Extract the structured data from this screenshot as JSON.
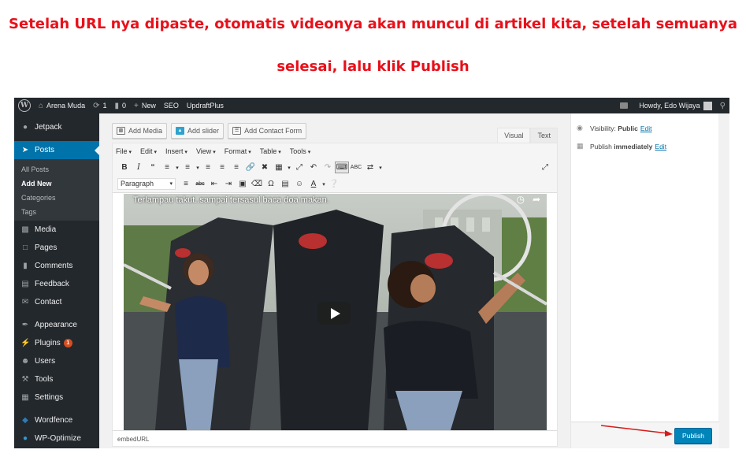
{
  "caption": {
    "line1": "Setelah URL nya dipaste, otomatis videonya akan muncul di artikel kita, setelah semuanya",
    "line2": "selesai, lalu klik Publish",
    "color": "#e8101a"
  },
  "adminbar": {
    "logo": "W",
    "site_name": "Arena Muda",
    "updates_count": "1",
    "comments_count": "0",
    "new_label": "New",
    "seo_label": "SEO",
    "updraft_label": "UpdraftPlus",
    "howdy": "Howdy, Edo Wijaya"
  },
  "sidebar": {
    "items": [
      {
        "label": "Jetpack",
        "icon": "jetpack-icon"
      },
      {
        "label": "Posts",
        "icon": "pin-icon"
      },
      {
        "label": "Media",
        "icon": "media-icon"
      },
      {
        "label": "Pages",
        "icon": "pages-icon"
      },
      {
        "label": "Comments",
        "icon": "comments-icon"
      },
      {
        "label": "Feedback",
        "icon": "feedback-icon"
      },
      {
        "label": "Contact",
        "icon": "mail-icon"
      },
      {
        "label": "Appearance",
        "icon": "brush-icon"
      },
      {
        "label": "Plugins",
        "icon": "plugin-icon",
        "badge": "1"
      },
      {
        "label": "Users",
        "icon": "users-icon"
      },
      {
        "label": "Tools",
        "icon": "wrench-icon"
      },
      {
        "label": "Settings",
        "icon": "settings-icon"
      },
      {
        "label": "Wordfence",
        "icon": "wordfence-icon"
      },
      {
        "label": "WP-Optimize",
        "icon": "optimize-icon"
      }
    ],
    "posts_submenu": [
      "All Posts",
      "Add New",
      "Categories",
      "Tags"
    ],
    "accent": "#0073aa"
  },
  "editor": {
    "buttons": {
      "add_media": "Add Media",
      "add_slider": "Add slider",
      "add_contact_form": "Add Contact Form"
    },
    "tabs": {
      "visual": "Visual",
      "text": "Text"
    },
    "menus": [
      "File",
      "Edit",
      "Insert",
      "View",
      "Format",
      "Table",
      "Tools"
    ],
    "format_select": "Paragraph",
    "video_title": "Terlampau takut..sampai tersasul baca doa makan.",
    "path": "embedURL"
  },
  "publish": {
    "visibility_label": "Visibility:",
    "visibility_value": "Public",
    "edit_label": "Edit",
    "publish_prefix": "Publish",
    "publish_value": "immediately",
    "publish_button": "Publish",
    "button_color": "#0085ba"
  }
}
